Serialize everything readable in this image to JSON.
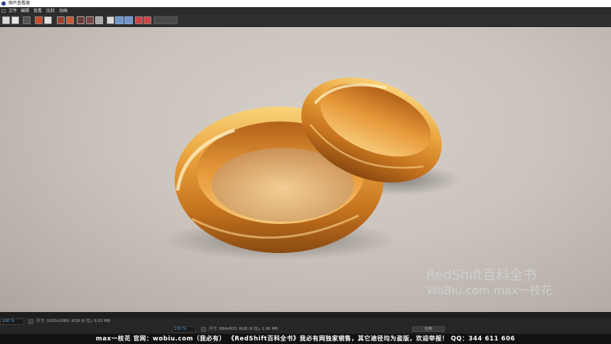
{
  "window": {
    "title": "图片查看器"
  },
  "menu": {
    "items": [
      "文件",
      "编辑",
      "查看",
      "比较",
      "动画"
    ]
  },
  "toolbar": {
    "icons": [
      "open-icon",
      "save-icon",
      "copy-icon",
      "stereo-icon",
      "render-icon",
      "channel-r-icon",
      "channel-g-icon",
      "alpha-icon",
      "filter-icon",
      "compare-icon",
      "ab-icon",
      "layout-a-icon",
      "layout-b-icon",
      "layout-c-icon",
      "layout-d-icon",
      "layout-e-icon"
    ]
  },
  "viewer": {
    "content": "two gold rings on a fabric surface"
  },
  "watermark": {
    "line1": "RedShift百科全书",
    "line2": "WoBiu.com  max一枝花"
  },
  "status_bar_1": {
    "zoom": "100 %",
    "info": "尺寸: 1920x1080, RGB (8 位), 6.03 MB"
  },
  "status_bar_2": {
    "zoom": "100 %",
    "info": "尺寸: 694x900, RGB (8 位), 1.96 MB",
    "apply_label": "应用"
  },
  "footer": {
    "text": "max一枝花 官网：wobiu.com（我必有）  《RedShift百科全书》我必有网独家销售，其它途径均为盗版，欢迎举报！  QQ：344 611 606"
  },
  "colors": {
    "gold": "#e8a23c",
    "background": "#cbc4bd",
    "accent": "#5aa7e8"
  }
}
